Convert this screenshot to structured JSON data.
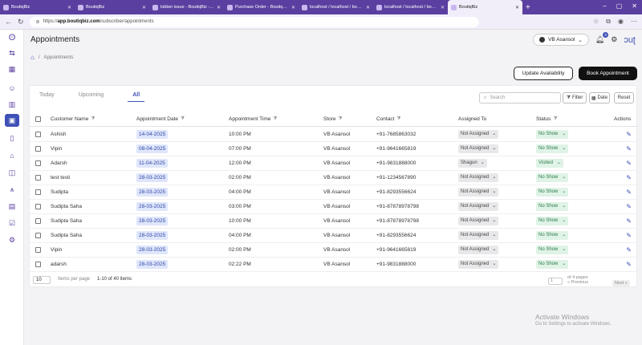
{
  "browser": {
    "tabs": [
      {
        "title": "BoutiqBiz",
        "active": false
      },
      {
        "title": "BoutiqBiz",
        "active": false
      },
      {
        "title": "lobber issue - BoutiqBiz - 10 All",
        "active": false
      },
      {
        "title": "Purchase Order - BoutiqBiz - 10...",
        "active": false
      },
      {
        "title": "localhost / localhost / boutiqbiz",
        "active": false
      },
      {
        "title": "localhost / localhost / boutiqbiz",
        "active": false
      },
      {
        "title": "BoutiqBiz",
        "active": true
      }
    ],
    "new_tab": "+",
    "url_host": "app.boutiqbiz.com",
    "url_path": "/subscriber/appointments",
    "url_prefix": "https://"
  },
  "header": {
    "title": "Appointments",
    "store_name": "VB Asansol",
    "notification_count": "0",
    "logo": "BoutiqBiz"
  },
  "breadcrumb": {
    "current": "Appointments",
    "separator": "/"
  },
  "actions": {
    "update_availability": "Update Availability",
    "book_appointment": "Book Appointment"
  },
  "tabs": [
    {
      "label": "Today",
      "active": false
    },
    {
      "label": "Upcoming",
      "active": false
    },
    {
      "label": "All",
      "active": true
    }
  ],
  "search": {
    "placeholder": "Search"
  },
  "filter_buttons": {
    "filter": "Filter",
    "date": "Date",
    "reset": "Reset"
  },
  "columns": [
    "Customer Name",
    "Appointment Date",
    "Appointment Time",
    "Store",
    "Contact",
    "Assigned To",
    "Status",
    "Actions"
  ],
  "rows": [
    {
      "customer": "Ashish",
      "date": "14-04-2025",
      "time": "10:00 PM",
      "store": "VB Asansol",
      "contact": "+91-7685863032",
      "assigned": "Not Assigned",
      "status": "No Show"
    },
    {
      "customer": "Vipin",
      "date": "08-04-2025",
      "time": "07:00 PM",
      "store": "VB Asansol",
      "contact": "+91-9641665819",
      "assigned": "Not Assigned",
      "status": "No Show"
    },
    {
      "customer": "Adarsh",
      "date": "11-04-2025",
      "time": "12:00 PM",
      "store": "VB Asansol",
      "contact": "+91-9831888000",
      "assigned": "Shagun",
      "status": "Visited"
    },
    {
      "customer": "test testi",
      "date": "28-03-2025",
      "time": "02:00 PM",
      "store": "VB Asansol",
      "contact": "+91-1234567890",
      "assigned": "Not Assigned",
      "status": "No Show"
    },
    {
      "customer": "Sudipta",
      "date": "28-03-2025",
      "time": "04:00 PM",
      "store": "VB Asansol",
      "contact": "+91-8293556624",
      "assigned": "Not Assigned",
      "status": "No Show"
    },
    {
      "customer": "Sudipta Saha",
      "date": "28-03-2025",
      "time": "03:00 PM",
      "store": "VB Asansol",
      "contact": "+91-87878978798",
      "assigned": "Not Assigned",
      "status": "No Show"
    },
    {
      "customer": "Sudipta Saha",
      "date": "28-03-2025",
      "time": "10:00 PM",
      "store": "VB Asansol",
      "contact": "+91-87878978798",
      "assigned": "Not Assigned",
      "status": "No Show"
    },
    {
      "customer": "Sudipta Saha",
      "date": "28-03-2025",
      "time": "04:00 PM",
      "store": "VB Asansol",
      "contact": "+91-8293556624",
      "assigned": "Not Assigned",
      "status": "No Show"
    },
    {
      "customer": "Vipin",
      "date": "28-03-2025",
      "time": "02:00 PM",
      "store": "VB Asansol",
      "contact": "+91-9641665819",
      "assigned": "Not Assigned",
      "status": "No Show"
    },
    {
      "customer": "adarsh",
      "date": "28-03-2025",
      "time": "02:22 PM",
      "store": "VB Asansol",
      "contact": "+91-9831888000",
      "assigned": "Not Assigned",
      "status": "No Show"
    }
  ],
  "pagination": {
    "per_page": "10",
    "per_page_label": "Items per page",
    "range": "1-10 of 40 items",
    "page": "1",
    "of_pages": "of 4 pages",
    "prev": "« Previous",
    "next": "Next »"
  },
  "watermark": {
    "line1": "Activate Windows",
    "line2": "Go to Settings to activate Windows."
  },
  "colors": {
    "brand": "#5b3fa0",
    "accent": "#3f51b5",
    "status_green": "#dff3e6",
    "date_chip": "#dfe6fb"
  },
  "icons": [
    "home-icon",
    "calendar-icon",
    "bell-icon",
    "gear-icon",
    "filter-icon",
    "search-icon",
    "edit-icon"
  ]
}
